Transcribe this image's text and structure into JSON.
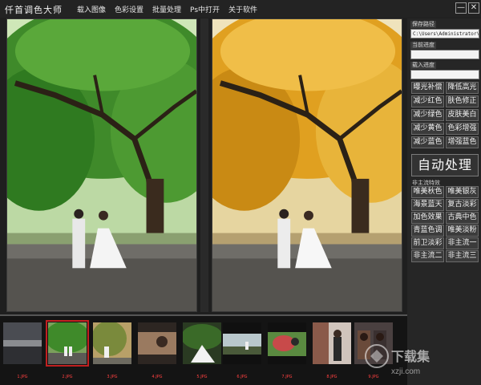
{
  "app": {
    "title": "仟首调色大师"
  },
  "menu": {
    "items": [
      {
        "label": "载入图像"
      },
      {
        "label": "色彩设置"
      },
      {
        "label": "批量处理"
      },
      {
        "label": "Ps中打开"
      },
      {
        "label": "关于软件"
      }
    ]
  },
  "window": {
    "minimize": "—",
    "close": "✕"
  },
  "panel": {
    "save_path_label": "保存路径",
    "save_path_value": "C:\\Users\\Administrator\\Desktop",
    "current_progress_label": "当前进度",
    "load_progress_label": "载入进度",
    "auto_button": "自动处理",
    "section_label": "非主流特效",
    "buttons_top": [
      [
        "曝光补偿",
        "降低高光"
      ],
      [
        "减少红色",
        "肤色修正"
      ],
      [
        "减少绿色",
        "皮肤美白"
      ],
      [
        "减少黄色",
        "色彩增强"
      ],
      [
        "减少蓝色",
        "增强蓝色"
      ]
    ],
    "buttons_bottom": [
      [
        "唯美秋色",
        "唯美银灰"
      ],
      [
        "海景蓝天",
        "复古淡彩"
      ],
      [
        "加色效果",
        "古典中色"
      ],
      [
        "青蓝色调",
        "唯美淡粉"
      ],
      [
        "前卫淡彩",
        "非主流一"
      ],
      [
        "非主流二",
        "非主流三"
      ]
    ]
  },
  "filmstrip": {
    "thumbs": [
      {
        "label": "1.JPG",
        "selected": false
      },
      {
        "label": "2.JPG",
        "selected": true
      },
      {
        "label": "3.JPG",
        "selected": false
      },
      {
        "label": "4.JPG",
        "selected": false
      },
      {
        "label": "5.JPG",
        "selected": false
      },
      {
        "label": "6.JPG",
        "selected": false
      },
      {
        "label": "7.JPG",
        "selected": false
      },
      {
        "label": "8.JPG",
        "selected": false
      },
      {
        "label": "9.JPG",
        "selected": false
      }
    ]
  },
  "watermark": {
    "name": "下载集",
    "site": "xzji.com"
  },
  "colors": {
    "accent": "#c02020",
    "leaf_green": "#3f8a2a",
    "leaf_gold": "#e0a020"
  }
}
